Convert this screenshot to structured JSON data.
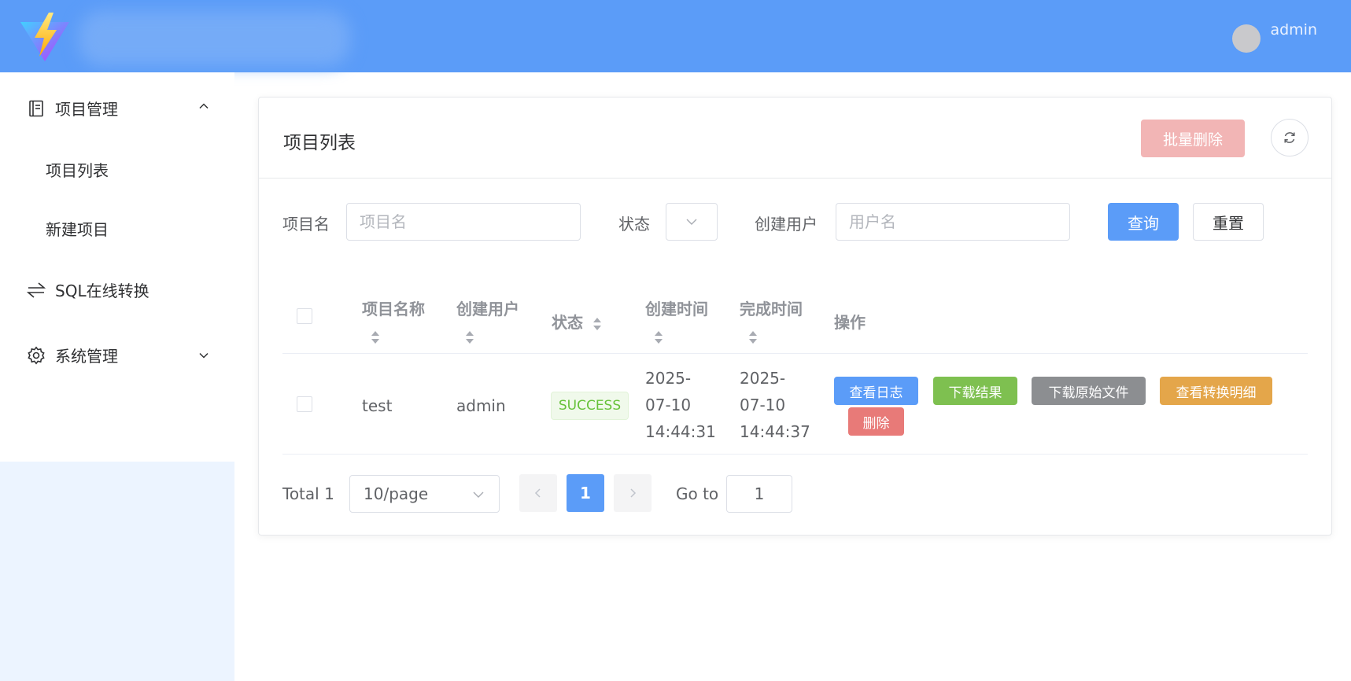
{
  "header": {
    "user_name": "admin"
  },
  "sidebar": {
    "items": [
      {
        "label": "项目管理",
        "icon": "document-icon",
        "expanded": true,
        "children": [
          {
            "label": "项目列表"
          },
          {
            "label": "新建项目"
          }
        ]
      },
      {
        "label": "SQL在线转换",
        "icon": "switch-icon"
      },
      {
        "label": "系统管理",
        "icon": "gear-icon",
        "expanded": false
      }
    ]
  },
  "card": {
    "title": "项目列表",
    "batch_delete_label": "批量删除"
  },
  "filters": {
    "project_name_label": "项目名",
    "project_name_placeholder": "项目名",
    "status_label": "状态",
    "creator_label": "创建用户",
    "creator_placeholder": "用户名",
    "query_label": "查询",
    "reset_label": "重置"
  },
  "table": {
    "columns": [
      "项目名称",
      "创建用户",
      "状态",
      "创建时间",
      "完成时间",
      "操作"
    ],
    "rows": [
      {
        "name": "test",
        "creator": "admin",
        "status": "SUCCESS",
        "created_at": [
          "2025-",
          "07-10",
          "14:44:31"
        ],
        "finished_at": [
          "2025-",
          "07-10",
          "14:44:37"
        ],
        "actions": [
          "查看日志",
          "下载结果",
          "下载原始文件",
          "查看转换明细",
          "删除"
        ]
      }
    ]
  },
  "pagination": {
    "total_label": "Total 1",
    "page_size": "10/page",
    "current_page": "1",
    "goto_label": "Go to",
    "goto_value": "1"
  },
  "colors": {
    "primary": "#5b9cf8",
    "success": "#67c23a",
    "action_green": "#7ec050",
    "action_gray": "#8c8e91",
    "action_orange": "#e4a64a",
    "danger": "#e87a78",
    "sidebar_bg": "#ecf4ff"
  }
}
